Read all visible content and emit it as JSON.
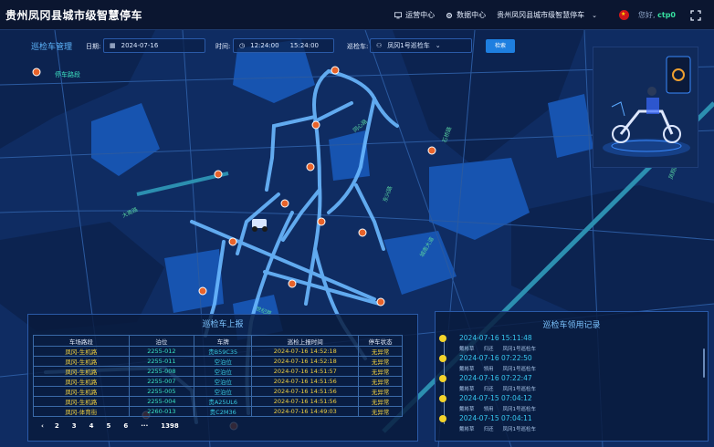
{
  "app": {
    "title": "贵州凤冈县城市级智慧停车"
  },
  "nav": {
    "items": [
      {
        "icon": "monitor-icon",
        "label": "运营中心"
      },
      {
        "icon": "gear-icon",
        "label": "数据中心"
      },
      {
        "label": "贵州凤冈县城市级智慧停车"
      }
    ],
    "greeting": "您好,",
    "username": "ctp0"
  },
  "filter": {
    "section_title": "巡检车管理",
    "date_label": "日期:",
    "date_value": "2024-07-16",
    "time_label": "时间:",
    "time_start": "12:24:00",
    "time_end": "15:24:00",
    "vehicle_label": "巡检车:",
    "vehicle_value": "凤冈1号巡检车",
    "search_label": "检索"
  },
  "map": {
    "route_tag": "停车路段",
    "road_labels": [
      "大南路",
      "城南大道",
      "东兴路",
      "石桥路",
      "世纪路",
      "同心路",
      "凤翔路"
    ],
    "colors": {
      "water": "#0b1f4a",
      "land": "#133a7a",
      "road": "#5aa8ff",
      "marker": "#e8632a"
    }
  },
  "report_panel": {
    "title": "巡检车上报",
    "columns": [
      "车场路段",
      "泊位",
      "车牌",
      "巡检上报时间",
      "停车状态"
    ],
    "rows": [
      [
        "凤冈-生机路",
        "2255-012",
        "贵B59C35",
        "2024-07-16 14:52:18",
        "无异常"
      ],
      [
        "凤冈-生机路",
        "2255-011",
        "空泊位",
        "2024-07-16 14:52:18",
        "无异常"
      ],
      [
        "凤冈-生机路",
        "2255-008",
        "空泊位",
        "2024-07-16 14:51:57",
        "无异常"
      ],
      [
        "凤冈-生机路",
        "2255-007",
        "空泊位",
        "2024-07-16 14:51:56",
        "无异常"
      ],
      [
        "凤冈-生机路",
        "2255-005",
        "空泊位",
        "2024-07-16 14:51:56",
        "无异常"
      ],
      [
        "凤冈-生机路",
        "2255-004",
        "贵A25UL6",
        "2024-07-16 14:51:56",
        "无异常"
      ],
      [
        "凤冈-体育街",
        "2260-013",
        "贵C2M36",
        "2024-07-16 14:49:03",
        "无异常"
      ]
    ],
    "pages": [
      "2",
      "3",
      "4",
      "5",
      "6",
      "···",
      "1398"
    ]
  },
  "log_panel": {
    "title": "巡检车领用记录",
    "items": [
      {
        "time": "2024-07-16 15:11:48",
        "detail": [
          "戴彬草",
          "归还",
          "凤冈1号巡检车"
        ]
      },
      {
        "time": "2024-07-16 07:22:50",
        "detail": [
          "戴彬草",
          "领用",
          "凤冈1号巡检车"
        ]
      },
      {
        "time": "2024-07-16 07:22:47",
        "detail": [
          "戴彬草",
          "归还",
          "凤冈1号巡检车"
        ]
      },
      {
        "time": "2024-07-15 07:04:12",
        "detail": [
          "戴彬草",
          "领用",
          "凤冈1号巡检车"
        ]
      },
      {
        "time": "2024-07-15 07:04:11",
        "detail": [
          "戴彬草",
          "归还",
          "凤冈1号巡检车"
        ]
      }
    ]
  }
}
